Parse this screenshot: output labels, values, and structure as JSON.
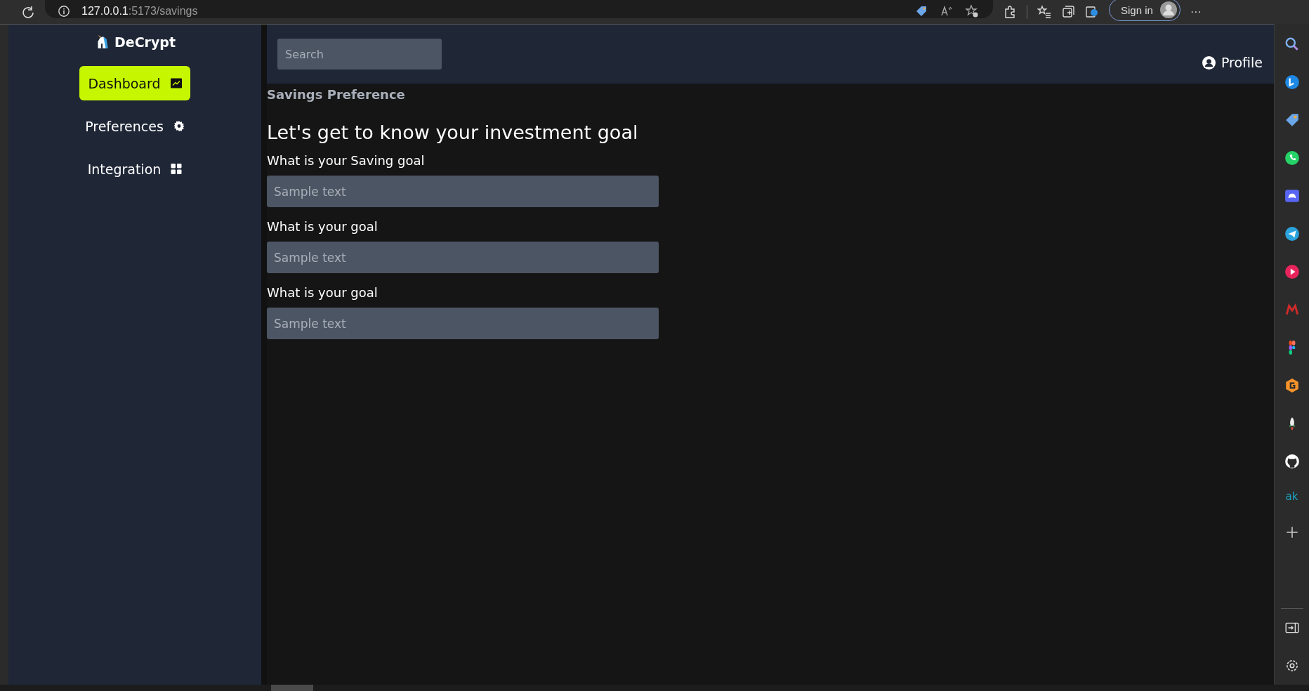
{
  "browser": {
    "url_host": "127.0.0.1",
    "url_path": ":5173/savings",
    "sign_in": "Sign in",
    "more": "···"
  },
  "brand": "DeCrypt",
  "nav": [
    {
      "label": "Dashboard",
      "kind": "chart",
      "selected": true
    },
    {
      "label": "Preferences",
      "kind": "gear",
      "selected": false
    },
    {
      "label": "Integration",
      "kind": "grid",
      "selected": false
    }
  ],
  "search": {
    "placeholder": "Search"
  },
  "profile": "Profile",
  "breadcrumb": "Savings Preference",
  "heading": "Let's get to know your investment goal",
  "questions": [
    {
      "label": "What is your Saving goal",
      "placeholder": "Sample text"
    },
    {
      "label": "What is your goal",
      "placeholder": "Sample text"
    },
    {
      "label": "What is your goal",
      "placeholder": "Sample text"
    }
  ],
  "edge_bar": {
    "ak_label": "ak"
  }
}
